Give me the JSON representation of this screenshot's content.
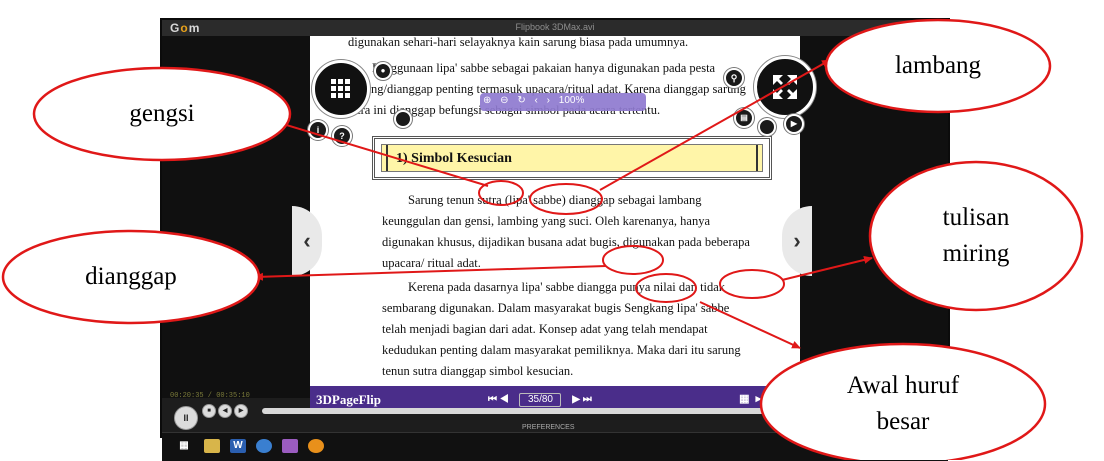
{
  "window": {
    "logo_prefix": "G",
    "logo_middle": "o",
    "logo_suffix": "m",
    "title": "Flipbook 3DMax.avi"
  },
  "book": {
    "line1": "digunakan sehari-hari selayaknya kain sarung biasa pada umumnya.",
    "para2_l1": "Penggunaan lipa' sabbe sebagai pakaian hanya digunakan pada pesta",
    "para2_l2": "penting/dianggap penting termasuk upacara/ritual adat. Karena dianggap sarung",
    "para2_l3": "sutra ini dianggap befungsi sebagai simbol pada acara tertentu.",
    "heading": "1)  Simbol Kesucian",
    "para3_l1": "Sarung tenun sutra (lipa' sabbe) dianggap sebagai lambang",
    "para3_l2": "keunggulan dan gensi, lambing yang suci. Oleh karenanya, hanya",
    "para3_l3": "digunakan khusus, dijadikan busana adat bugis, digunakan pada beberapa",
    "para3_l4": "upacara/ ritual adat.",
    "para4_l1": "Kerena pada dasarnya lipa' sabbe diangga punya nilai dan tidak",
    "para4_l2": "sembarang digunakan. Dalam masyarakat bugis Sengkang lipa' sabbe",
    "para4_l3": "telah menjadi bagian dari adat. Konsep adat yang telah mendapat",
    "para4_l4": "kedudukan penting dalam masyarakat pemiliknya. Maka dari itu sarung",
    "para4_l5": "tenun sutra dianggap simbol kesucian."
  },
  "zoombar": {
    "zoom_level": "100%"
  },
  "flipbar": {
    "brand": "3DPageFlip",
    "page_indicator": "35/80"
  },
  "player": {
    "time": "00:20:35 / 00:35:10",
    "preferences": "PREFERENCES"
  },
  "callouts": {
    "gengsi": "gengsi",
    "dianggap": "dianggap",
    "lambang": "lambang",
    "tulisan_miring_1": "tulisan",
    "tulisan_miring_2": "miring",
    "awal_huruf_1": "Awal huruf",
    "awal_huruf_2": "besar"
  },
  "colors": {
    "accent_purple": "#4a2d8a",
    "heading_fill": "#fff5a8",
    "annotation_red": "#e01818"
  }
}
